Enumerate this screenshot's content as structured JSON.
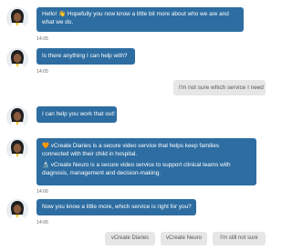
{
  "colors": {
    "bot_bubble": "#2d6da1",
    "user_bubble": "#e6e6e6",
    "timestamp": "#6d6d6d"
  },
  "messages": [
    {
      "from": "bot",
      "lines": [
        "Hello! 👋 Hopefully you now know a little bit more about who we are and",
        "what we do."
      ],
      "time": "14:05"
    },
    {
      "from": "bot",
      "text": "Is there anything I can help with?",
      "time": "14:05"
    },
    {
      "from": "user",
      "text": "I'm not sure which service I need"
    },
    {
      "from": "bot",
      "text": "I can help you work that out!"
    },
    {
      "from": "bot",
      "para1_icon": "orange-heart-icon",
      "para1_lines": [
        "vCreate Diaries is a secure video service that helps keep families",
        "connected with their child in hospital."
      ],
      "para2_icon": "microscope-icon",
      "para2_lines": [
        "vCreate Neuro is a secure video service to support clinical teams with",
        "diagnosis, management and decision-making."
      ],
      "time": "14:06"
    },
    {
      "from": "bot",
      "text": "Now you know a little more, which service is right for you?",
      "time": "14:06"
    }
  ],
  "quick_replies": [
    "vCreate Diaries",
    "vCreate Neuro",
    "I'm still not sure"
  ]
}
